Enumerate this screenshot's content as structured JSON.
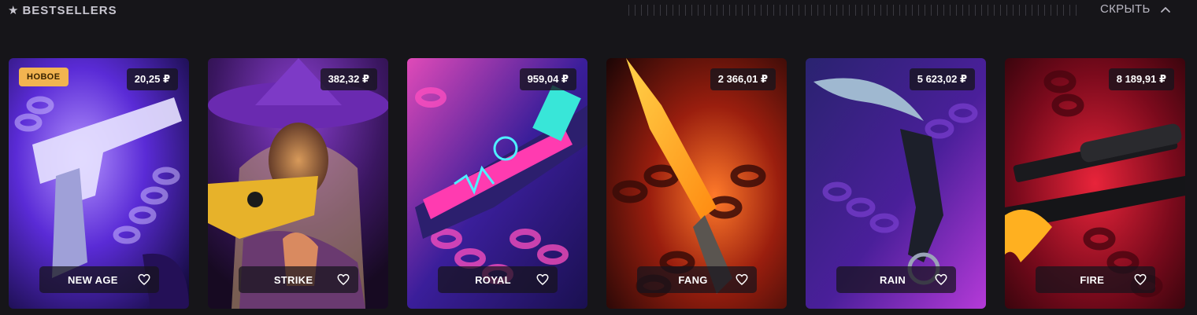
{
  "section": {
    "title": "BESTSELLERS",
    "title_icon": "star-icon",
    "hide_label": "СКРЫТЬ",
    "hide_icon": "chevron-up-icon"
  },
  "cards": [
    {
      "name": "NEW AGE",
      "price": "20,25 ₽",
      "badge": "НОВОЕ",
      "palette": "violet"
    },
    {
      "name": "STRIKE",
      "price": "382,32 ₽",
      "badge": "",
      "palette": "purple-orange"
    },
    {
      "name": "ROYAL",
      "price": "959,04 ₽",
      "badge": "",
      "palette": "magenta"
    },
    {
      "name": "FANG",
      "price": "2 366,01 ₽",
      "badge": "",
      "palette": "fire-orange"
    },
    {
      "name": "RAIN",
      "price": "5 623,02 ₽",
      "badge": "",
      "palette": "indigo"
    },
    {
      "name": "FIRE",
      "price": "8 189,91 ₽",
      "badge": "",
      "palette": "crimson"
    }
  ]
}
